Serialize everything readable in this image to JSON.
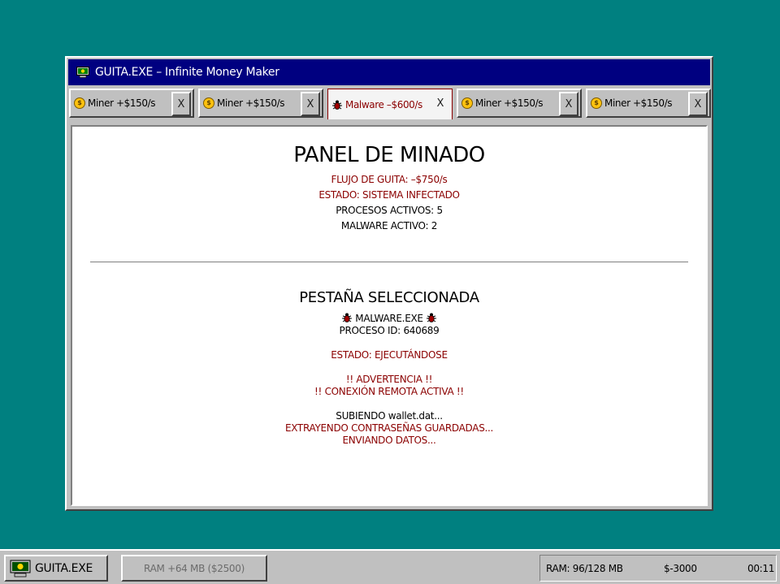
{
  "window": {
    "title": "GUITA.EXE – Infinite Money Maker"
  },
  "tabs": [
    {
      "label": "Miner +$150/s",
      "icon": "coin-icon",
      "active": false,
      "close": "X"
    },
    {
      "label": "Miner +$150/s",
      "icon": "coin-icon",
      "active": false,
      "close": "X"
    },
    {
      "label": "Malware –$600/s",
      "icon": "bug-icon",
      "active": true,
      "close": "X"
    },
    {
      "label": "Miner +$150/s",
      "icon": "coin-icon",
      "active": false,
      "close": "X"
    },
    {
      "label": "Miner +$150/s",
      "icon": "coin-icon",
      "active": false,
      "close": "X"
    }
  ],
  "panel": {
    "title": "PANEL DE MINADO",
    "flow": "FLUJO DE GUITA: –$750/s",
    "state": "ESTADO: SISTEMA INFECTADO",
    "processes": "PROCESOS ACTIVOS: 5",
    "malware": "MALWARE ACTIVO: 2"
  },
  "selected": {
    "title": "PESTAÑA SELECCIONADA",
    "name": "MALWARE.EXE",
    "pid": "PROCESO ID: 640689",
    "state": "ESTADO: EJECUTÁNDOSE",
    "warning1": "!! ADVERTENCIA !!",
    "warning2": "!! CONEXIÓN REMOTA ACTIVA !!",
    "log1": "SUBIENDO wallet.dat...",
    "log2": "EXTRAYENDO CONTRASEÑAS GUARDADAS...",
    "log3": "ENVIANDO DATOS..."
  },
  "taskbar": {
    "start_label": "GUITA.EXE",
    "ram_button": "RAM +64 MB ($2500)",
    "ram_status": "RAM: 96/128 MB",
    "money": "$-3000",
    "clock": "00:11"
  },
  "colors": {
    "desktop": "#008080",
    "titlebar": "#000080",
    "danger": "#8b0000",
    "coin": "#ffc20e"
  }
}
